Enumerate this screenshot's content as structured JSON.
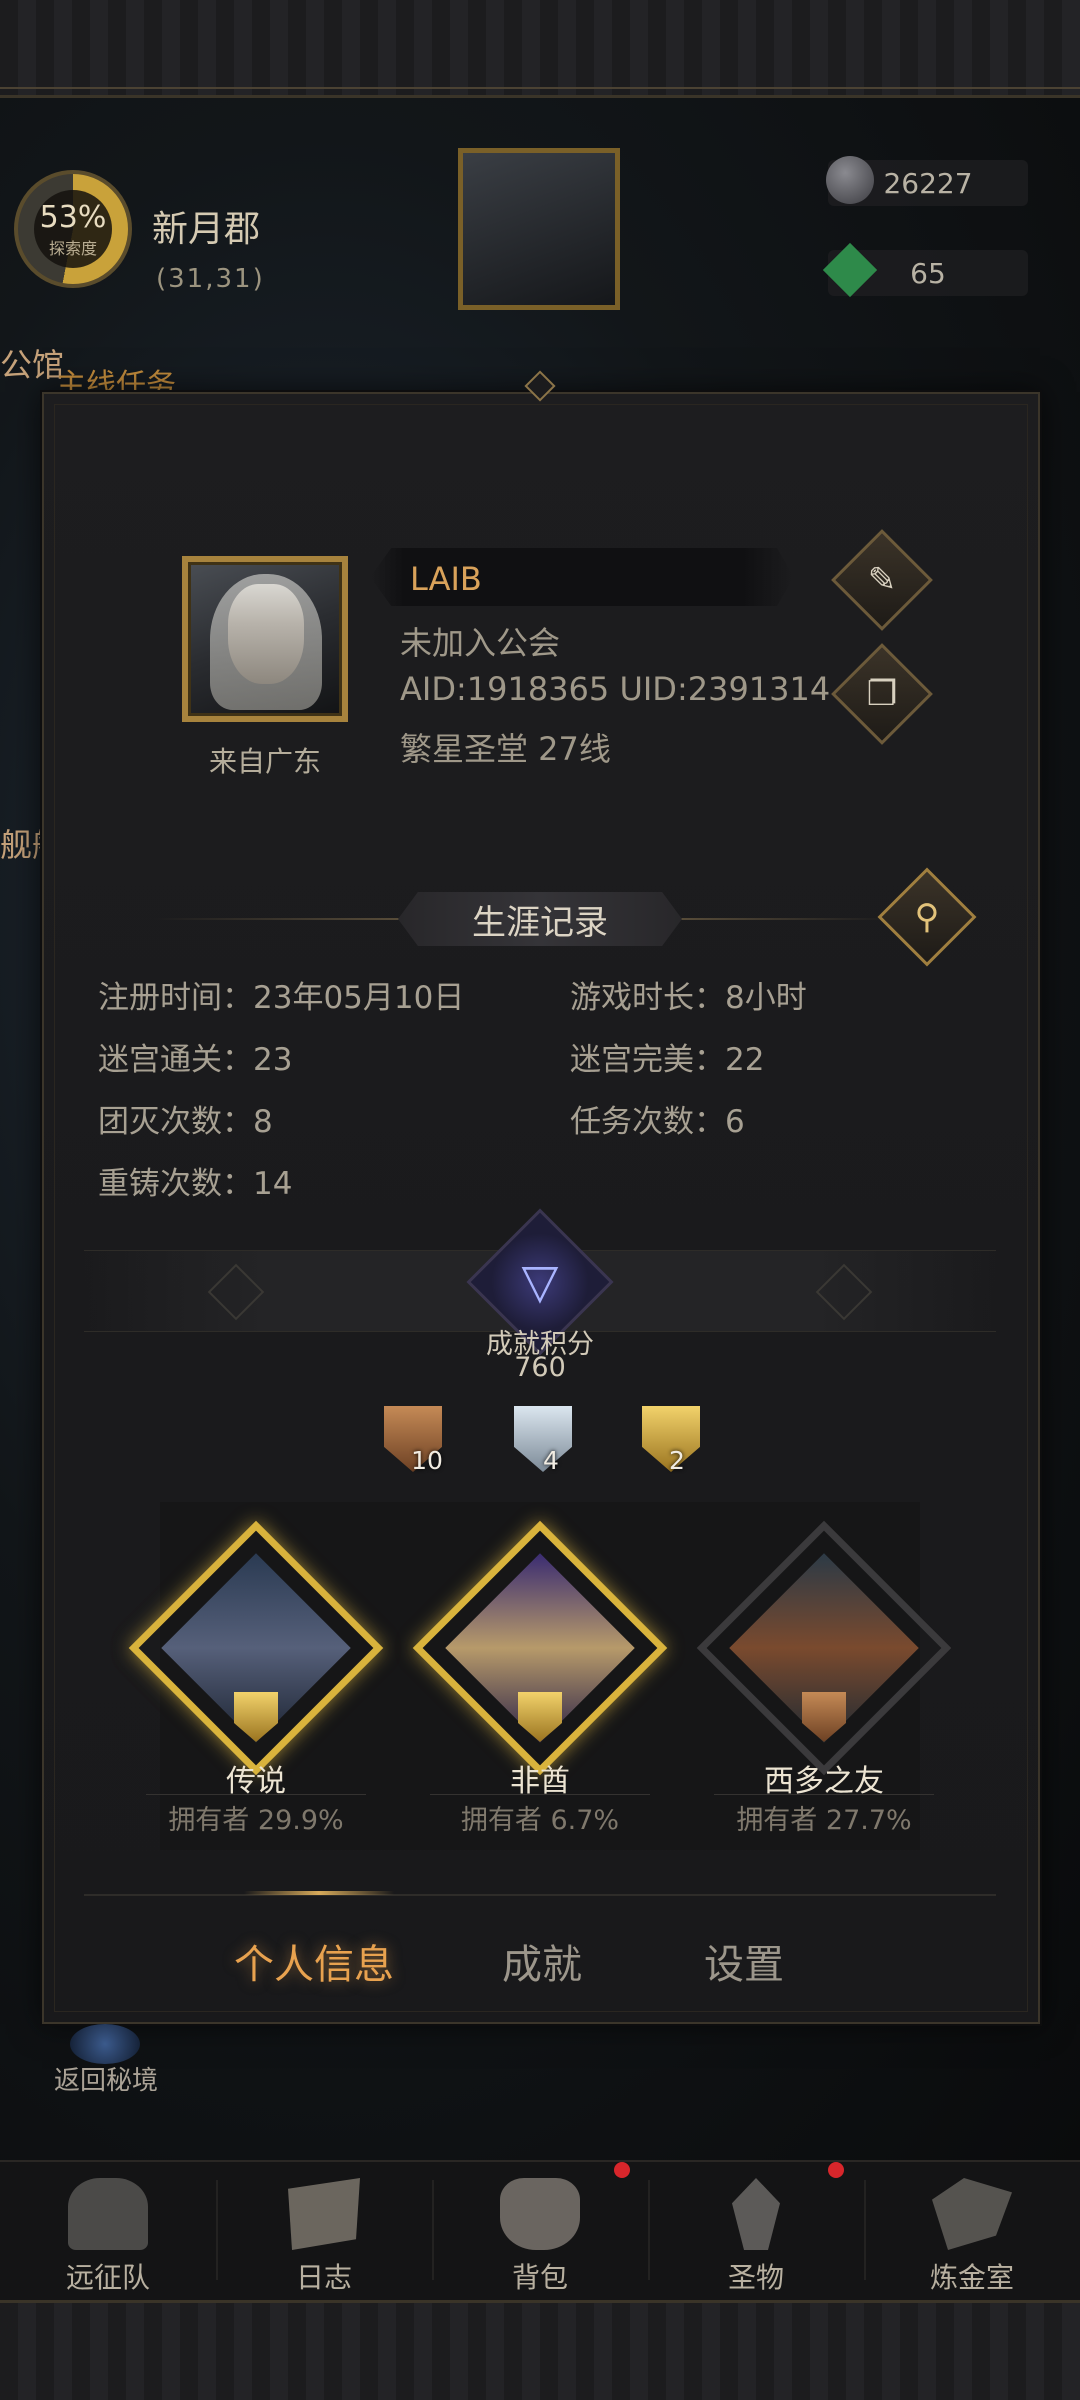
{
  "hud": {
    "explore_percent": "53%",
    "explore_label": "探索度",
    "region_name": "新月郡",
    "coords": "(31,31)",
    "stone_count": "26227",
    "gem_count": "65",
    "side_text_top": "公馆",
    "main_quest": "主线任务",
    "side_text_mid": "舰船"
  },
  "profile": {
    "name": "LAIB",
    "guild": "未加入公会",
    "ids": "AID:1918365  UID:2391314",
    "server": "繁星圣堂 27线",
    "origin": "来自广东"
  },
  "career": {
    "title": "生涯记录",
    "stats": [
      "注册时间：23年05月10日",
      "游戏时长：8小时",
      "迷宫通关：23",
      "迷宫完美：22",
      "团灭次数：8",
      "任务次数：6",
      "重铸次数：14"
    ]
  },
  "achievements": {
    "score_label": "成就积分",
    "score": "760",
    "medals": {
      "bronze": "10",
      "silver": "4",
      "gold": "2"
    },
    "cards": [
      {
        "name": "传说",
        "owners": "拥有者 29.9%",
        "tier": "gold"
      },
      {
        "name": "非酋",
        "owners": "拥有者 6.7%",
        "tier": "gold"
      },
      {
        "name": "西多之友",
        "owners": "拥有者 27.7%",
        "tier": "bronze"
      }
    ]
  },
  "tabs": [
    "个人信息",
    "成就",
    "设置"
  ],
  "return_label": "返回秘境",
  "bottom_nav": [
    "远征队",
    "日志",
    "背包",
    "圣物",
    "炼金室"
  ],
  "colors": {
    "accent_gold": "#d9a25a",
    "tab_active": "#e8a24f",
    "notification_red": "#d8262b"
  }
}
